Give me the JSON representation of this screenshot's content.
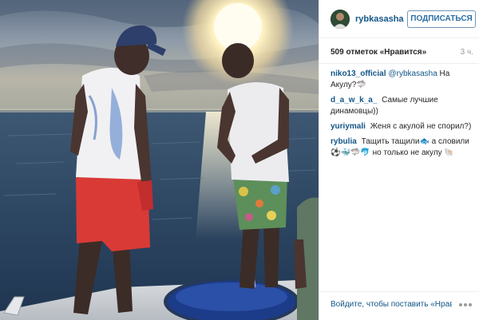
{
  "header": {
    "username": "rybkasasha",
    "follow_label": "ПОДПИСАТЬСЯ"
  },
  "stats": {
    "likes": "509 отметок «Нравится»",
    "age": "3 ч."
  },
  "comments": [
    {
      "user": "niko13_official",
      "mention": "@rybkasasha",
      "text": "На Акулу?🦈"
    },
    {
      "user": "d_a_w_k_a_",
      "mention": "",
      "text": "Самые лучшие динамовцы))"
    },
    {
      "user": "yuriymali",
      "mention": "",
      "text": "Женя с акулой не спорил?)"
    },
    {
      "user": "rybulia",
      "mention": "",
      "text": "Тащить тащили🐟 а словили ⚽️🐳🦈🐬 но только не акулу 🐚"
    }
  ],
  "footer": {
    "login_text": "Войдите, чтобы поставить «Нравится»",
    "more_icon": "ellipsis-icon"
  },
  "colors": {
    "link": "#125688",
    "follow_border": "#6f97b6",
    "follow_text": "#2b6ea4",
    "text": "#262626",
    "muted": "#999999"
  }
}
